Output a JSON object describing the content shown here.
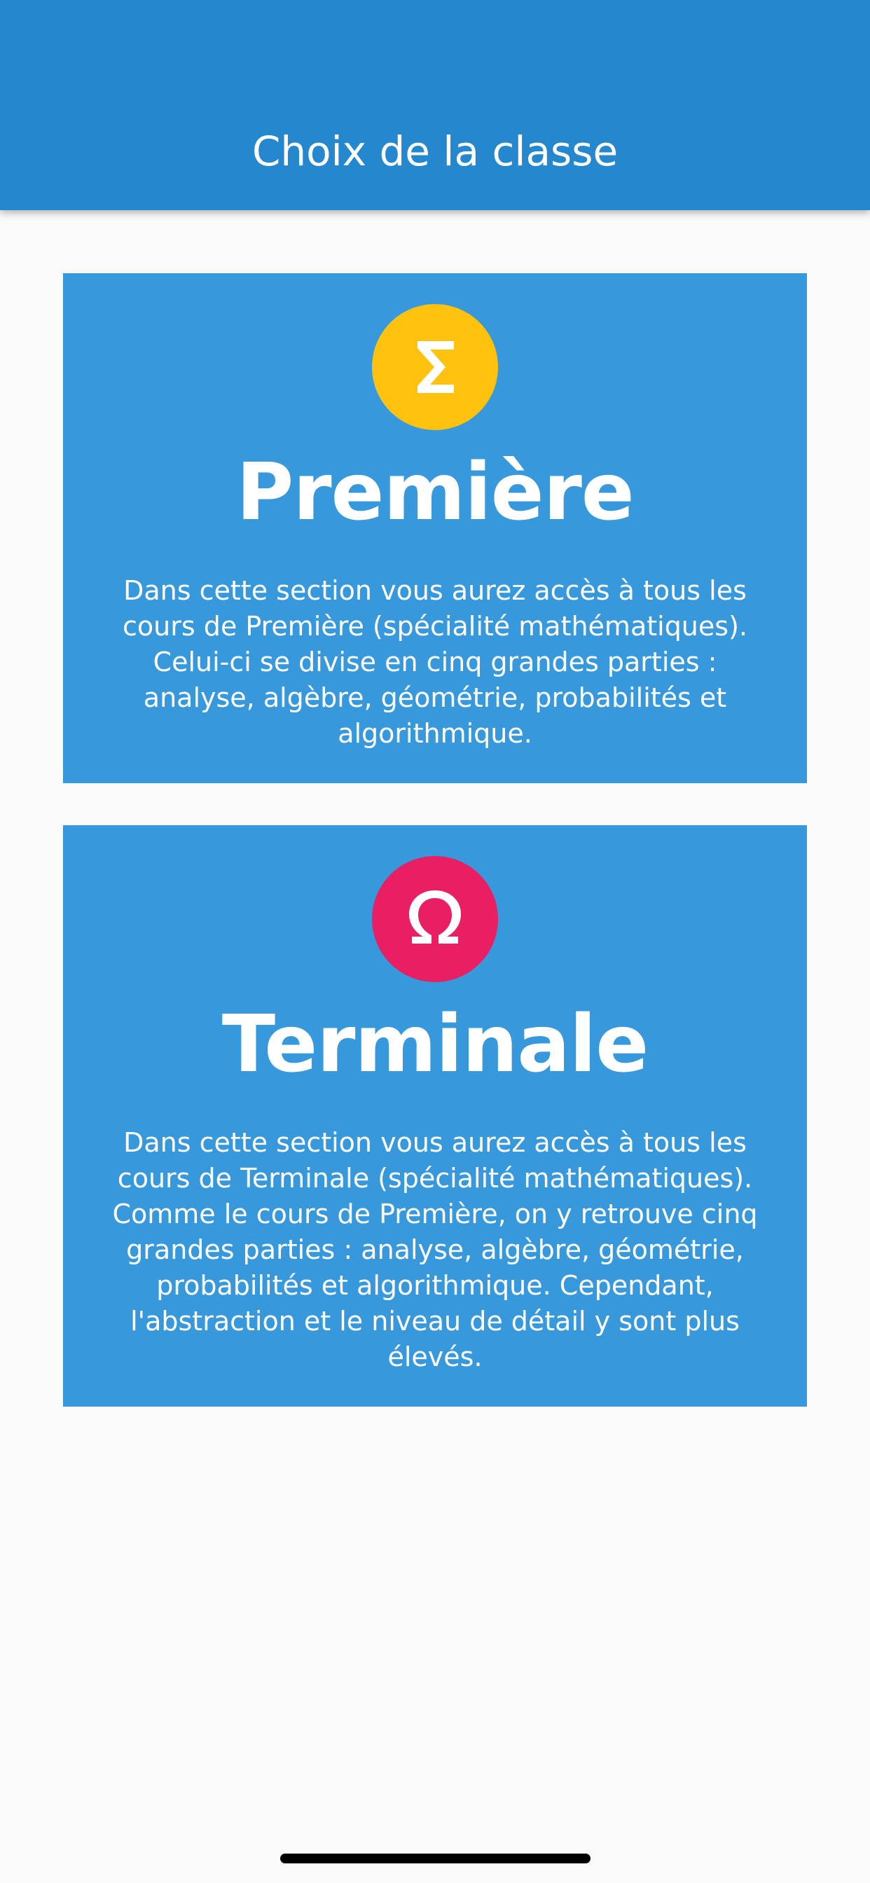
{
  "app_bar": {
    "title": "Choix de la classe",
    "color": "#2588cf"
  },
  "cards": [
    {
      "title": "Première",
      "icon": "sigma-icon",
      "icon_color": "#fec20f",
      "description": "Dans cette section vous aurez accès à tous les cours de Première (spécialité mathématiques). Celui-ci se divise en cinq grandes parties : analyse, algèbre, géométrie, probabilités et algorithmique."
    },
    {
      "title": "Terminale",
      "icon": "omega-icon",
      "icon_color": "#e91e63",
      "description": "Dans cette section vous aurez accès à tous les cours de Terminale (spécialité mathématiques). Comme le cours de Première, on y retrouve cinq grandes parties : analyse, algèbre, géométrie, probabilités et algorithmique. Cependant, l'abstraction et le niveau de détail y sont plus élevés."
    }
  ],
  "card_color": "#3898dc"
}
